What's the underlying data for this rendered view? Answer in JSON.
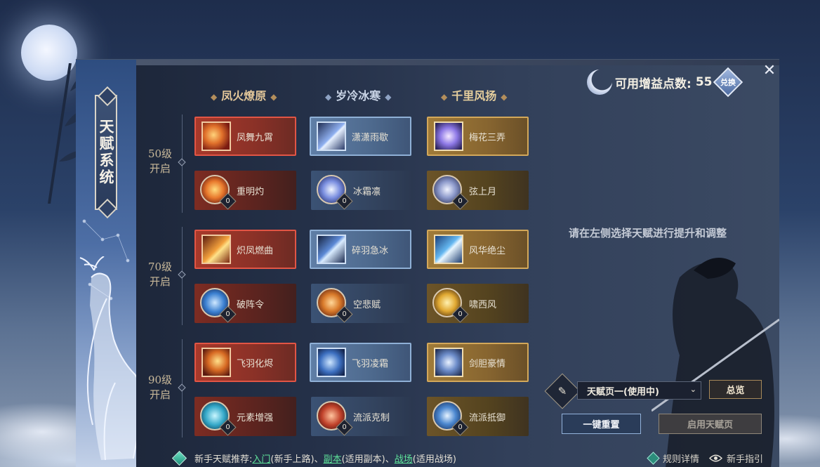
{
  "panel_title": "天赋系统",
  "columns": [
    {
      "name": "凤火燎原",
      "diamond": "◆"
    },
    {
      "name": "岁冷冰寒",
      "diamond": "◆"
    },
    {
      "name": "千里风扬",
      "diamond": "◆"
    }
  ],
  "tiers": [
    {
      "level": "50级",
      "status": "开启"
    },
    {
      "level": "70级",
      "status": "开启"
    },
    {
      "level": "90级",
      "status": "开启"
    }
  ],
  "talents": {
    "fire": [
      {
        "name": "凤舞九霄",
        "points": "",
        "selected": true
      },
      {
        "name": "重明灼",
        "points": "0"
      },
      {
        "name": "炽凤燃曲",
        "points": "",
        "selected": true
      },
      {
        "name": "破阵令",
        "points": "0"
      },
      {
        "name": "飞羽化烬",
        "points": "",
        "selected": true
      },
      {
        "name": "元素增强",
        "points": "0"
      }
    ],
    "frost": [
      {
        "name": "潇潇雨歇",
        "points": "",
        "selected": true
      },
      {
        "name": "冰霜凛",
        "points": "0"
      },
      {
        "name": "碎羽急冰",
        "points": "",
        "selected": true
      },
      {
        "name": "空悲赋",
        "points": "0"
      },
      {
        "name": "飞羽凌霜",
        "points": "",
        "selected": true
      },
      {
        "name": "流派克制",
        "points": "0"
      }
    ],
    "wind": [
      {
        "name": "梅花三弄",
        "points": "",
        "selected": true
      },
      {
        "name": "弦上月",
        "points": "0"
      },
      {
        "name": "风华绝尘",
        "points": "",
        "selected": true
      },
      {
        "name": "啸西风",
        "points": "0"
      },
      {
        "name": "剑胆豪情",
        "points": "",
        "selected": true
      },
      {
        "name": "流派抵御",
        "points": "0"
      }
    ]
  },
  "points": {
    "label": "可用增益点数:",
    "value": "55",
    "exchange_label": "兑换"
  },
  "close_symbol": "✕",
  "hint": "请在左侧选择天赋进行提升和调整",
  "edit_symbol": "✎",
  "page_select": {
    "value": "天赋页一(使用中)",
    "chevron": "⌄"
  },
  "buttons": {
    "overview": "总览",
    "reset": "一键重置",
    "enable": "启用天赋页"
  },
  "bottom": {
    "prefix": "新手天赋推荐:",
    "link1": "入门",
    "desc1": "(新手上路)、",
    "link2": "副本",
    "desc2": "(适用副本)、",
    "link3": "战场",
    "desc3": "(适用战场)",
    "rules": "规则详情",
    "guide": "新手指引"
  },
  "colors": {
    "fire": "#e25545",
    "frost": "#8fb0d6",
    "wind": "#d3a85a",
    "link": "#5ee39a"
  }
}
